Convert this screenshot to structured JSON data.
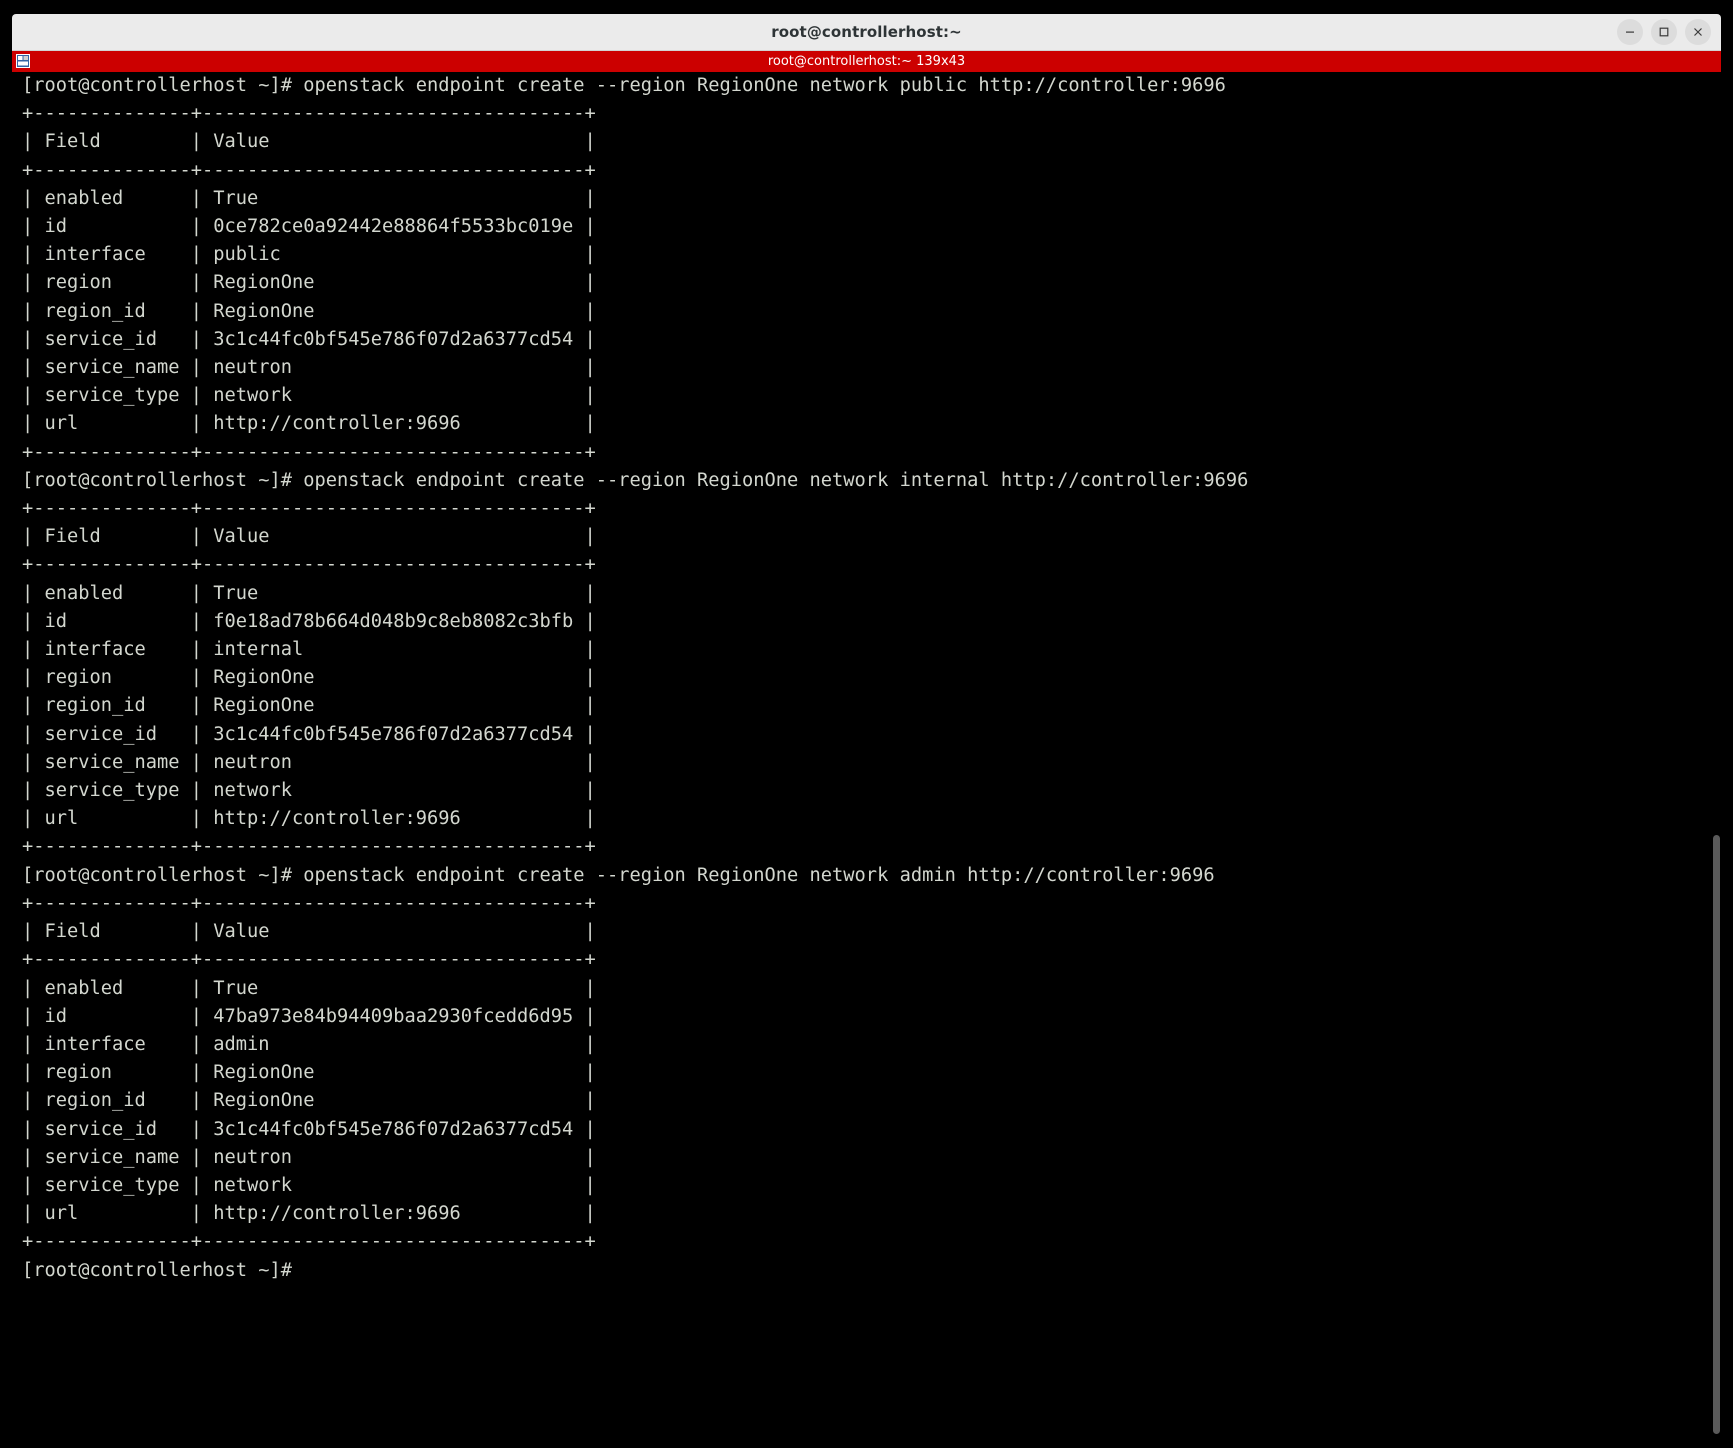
{
  "window": {
    "title": "root@controllerhost:~",
    "controls": {
      "minimize_label": "Minimize",
      "maximize_label": "Maximize",
      "close_label": "Close"
    }
  },
  "tab": {
    "label": "root@controllerhost:~ 139x43",
    "icon": "terminal-icon",
    "background_color": "#cc0000",
    "text_color": "#ffffff"
  },
  "terminal": {
    "background_color": "#000000",
    "foreground_color": "#d3d7cf",
    "columns": 139,
    "rows": 43,
    "prompt": "[root@controllerhost ~]#",
    "commands": [
      "openstack endpoint create --region RegionOne network public http://controller:9696",
      "openstack endpoint create --region RegionOne network internal http://controller:9696",
      "openstack endpoint create --region RegionOne network admin http://controller:9696"
    ],
    "table_headers": [
      "Field",
      "Value"
    ],
    "tables": [
      {
        "interface": "public",
        "rows": [
          [
            "enabled",
            "True"
          ],
          [
            "id",
            "0ce782ce0a92442e88864f5533bc019e"
          ],
          [
            "interface",
            "public"
          ],
          [
            "region",
            "RegionOne"
          ],
          [
            "region_id",
            "RegionOne"
          ],
          [
            "service_id",
            "3c1c44fc0bf545e786f07d2a6377cd54"
          ],
          [
            "service_name",
            "neutron"
          ],
          [
            "service_type",
            "network"
          ],
          [
            "url",
            "http://controller:9696"
          ]
        ]
      },
      {
        "interface": "internal",
        "rows": [
          [
            "enabled",
            "True"
          ],
          [
            "id",
            "f0e18ad78b664d048b9c8eb8082c3bfb"
          ],
          [
            "interface",
            "internal"
          ],
          [
            "region",
            "RegionOne"
          ],
          [
            "region_id",
            "RegionOne"
          ],
          [
            "service_id",
            "3c1c44fc0bf545e786f07d2a6377cd54"
          ],
          [
            "service_name",
            "neutron"
          ],
          [
            "service_type",
            "network"
          ],
          [
            "url",
            "http://controller:9696"
          ]
        ]
      },
      {
        "interface": "admin",
        "rows": [
          [
            "enabled",
            "True"
          ],
          [
            "id",
            "47ba973e84b94409baa2930fcedd6d95"
          ],
          [
            "interface",
            "admin"
          ],
          [
            "region",
            "RegionOne"
          ],
          [
            "region_id",
            "RegionOne"
          ],
          [
            "service_id",
            "3c1c44fc0bf545e786f07d2a6377cd54"
          ],
          [
            "service_name",
            "neutron"
          ],
          [
            "service_type",
            "network"
          ],
          [
            "url",
            "http://controller:9696"
          ]
        ]
      }
    ],
    "screen_text": "[root@controllerhost ~]# openstack endpoint create --region RegionOne network public http://controller:9696\n+--------------+----------------------------------+\n| Field        | Value                            |\n+--------------+----------------------------------+\n| enabled      | True                             |\n| id           | 0ce782ce0a92442e88864f5533bc019e |\n| interface    | public                           |\n| region       | RegionOne                        |\n| region_id    | RegionOne                        |\n| service_id   | 3c1c44fc0bf545e786f07d2a6377cd54 |\n| service_name | neutron                          |\n| service_type | network                          |\n| url          | http://controller:9696           |\n+--------------+----------------------------------+\n[root@controllerhost ~]# openstack endpoint create --region RegionOne network internal http://controller:9696\n+--------------+----------------------------------+\n| Field        | Value                            |\n+--------------+----------------------------------+\n| enabled      | True                             |\n| id           | f0e18ad78b664d048b9c8eb8082c3bfb |\n| interface    | internal                         |\n| region       | RegionOne                        |\n| region_id    | RegionOne                        |\n| service_id   | 3c1c44fc0bf545e786f07d2a6377cd54 |\n| service_name | neutron                          |\n| service_type | network                          |\n| url          | http://controller:9696           |\n+--------------+----------------------------------+\n[root@controllerhost ~]# openstack endpoint create --region RegionOne network admin http://controller:9696\n+--------------+----------------------------------+\n| Field        | Value                            |\n+--------------+----------------------------------+\n| enabled      | True                             |\n| id           | 47ba973e84b94409baa2930fcedd6d95 |\n| interface    | admin                            |\n| region       | RegionOne                        |\n| region_id    | RegionOne                        |\n| service_id   | 3c1c44fc0bf545e786f07d2a6377cd54 |\n| service_name | neutron                          |\n| service_type | network                          |\n| url          | http://controller:9696           |\n+--------------+----------------------------------+\n[root@controllerhost ~]# "
  }
}
